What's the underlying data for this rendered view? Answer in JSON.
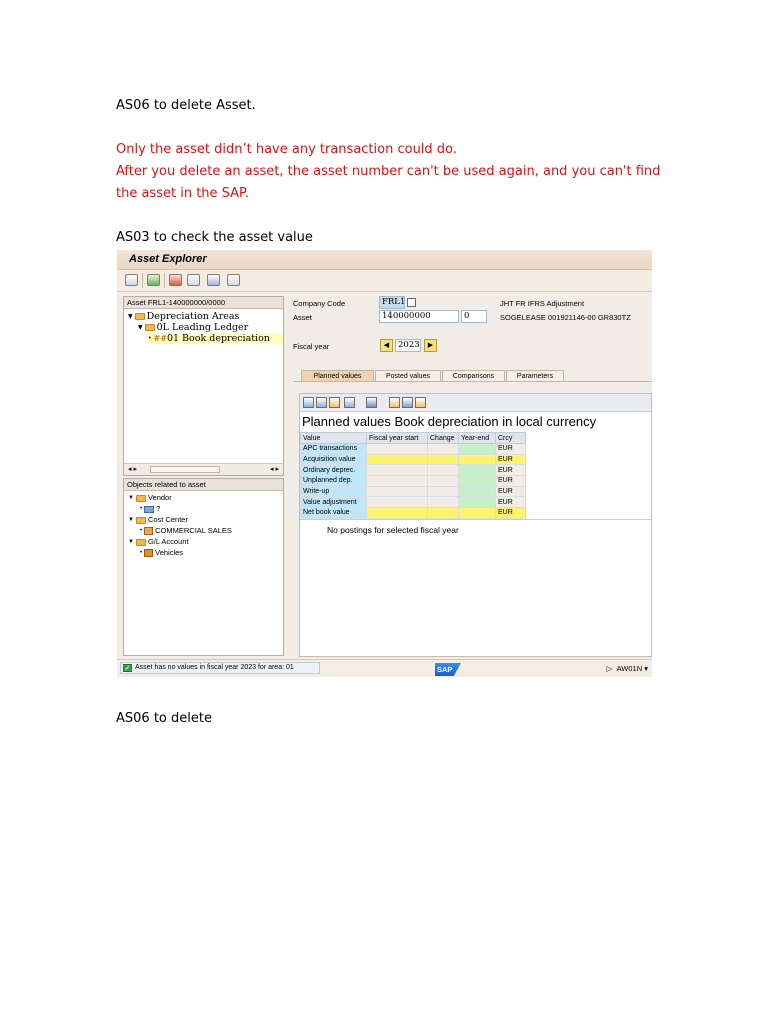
{
  "doc": {
    "heading1": "AS06 to delete Asset.",
    "note_line1": "Only the asset didn’t have any transaction could do.",
    "note_line2": "After you delete an asset, the asset number can't be used again, and you can't find",
    "note_line3": "the asset in the SAP.",
    "heading2": "AS03 to check the asset value",
    "heading3": "AS06 to delete"
  },
  "sap": {
    "window_title": "Asset Explorer",
    "tree": {
      "header": "Asset FRL1-140000000/0000",
      "items": [
        {
          "label": "Depreciation Areas"
        },
        {
          "label": "0L Leading Ledger"
        },
        {
          "label": "01 Book depreciation"
        }
      ]
    },
    "objects": {
      "header": "Objects related to asset",
      "vendor_label": "Vendor",
      "vendor_value": "?",
      "cost_center_label": "Cost Center",
      "cost_center_value": "COMMERCIAL SALES",
      "gl_label": "G/L Account",
      "gl_value": "Vehicles"
    },
    "header": {
      "company_code_label": "Company Code",
      "company_code_value": "FRL1",
      "company_name": "JHT FR IFRS Adjustment",
      "asset_label": "Asset",
      "asset_value": "140000000",
      "asset_sub": "0",
      "asset_desc": "SOGELEASE 001921146-00 GR830TZ",
      "fiscal_year_label": "Fiscal year",
      "fiscal_year_value": "2023"
    },
    "tabs": [
      "Planned values",
      "Posted values",
      "Comparisons",
      "Parameters"
    ],
    "content_title": "Planned values Book depreciation in local currency",
    "table": {
      "columns": [
        "Value",
        "Fiscal year start",
        "Change",
        "Year-end",
        "Crcy"
      ],
      "rows": [
        {
          "label": "APC transactions",
          "crcy": "EUR"
        },
        {
          "label": "Acquisition value",
          "crcy": "EUR"
        },
        {
          "label": "Ordinary deprec.",
          "crcy": "EUR"
        },
        {
          "label": "Unplanned dep.",
          "crcy": "EUR"
        },
        {
          "label": "Write-up",
          "crcy": "EUR"
        },
        {
          "label": "Value adjustment",
          "crcy": "EUR"
        },
        {
          "label": "Net book value",
          "crcy": "EUR"
        }
      ]
    },
    "no_postings": "No postings for selected fiscal year",
    "status_message": "Asset has no values in fiscal year 2023 for area: 01",
    "sap_logo": "SAP",
    "system": "AW01N"
  }
}
